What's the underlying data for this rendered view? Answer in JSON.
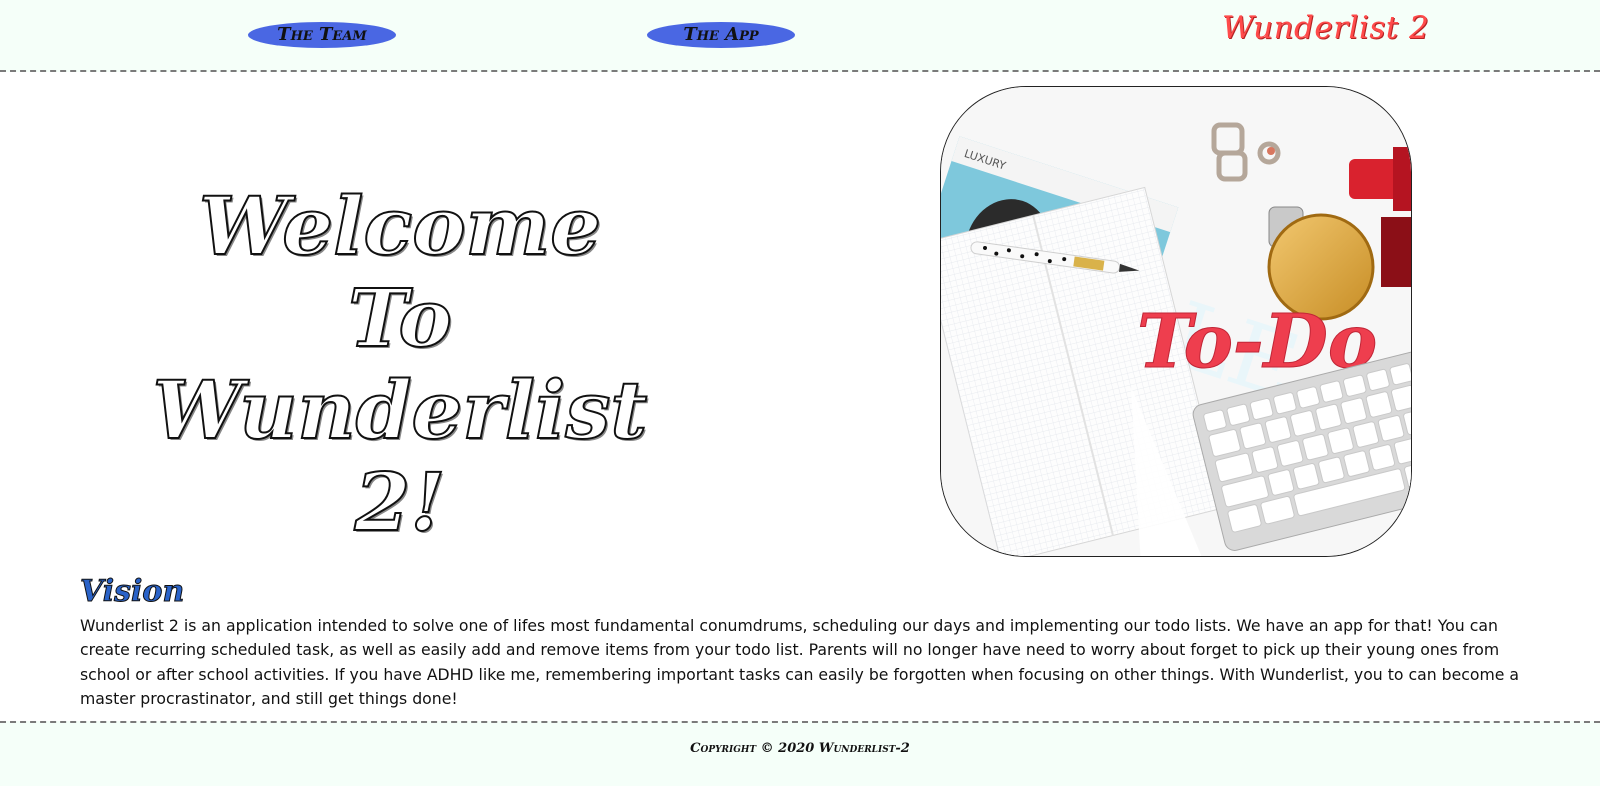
{
  "nav": {
    "team_label": "The Team",
    "app_label": "The App",
    "brand": "Wunderlist 2"
  },
  "hero": {
    "title_lines": [
      "Welcome",
      "To",
      "Wunderlist 2!"
    ],
    "image_text": "To-Do",
    "magazine_label": "LUXURY",
    "magazine_letters": "ELLE"
  },
  "vision": {
    "heading": "Vision",
    "body": "Wunderlist 2 is an application intended to solve one of lifes most fundamental conumdrums, scheduling our days and implementing our todo lists. We have an app for that! You can create recurring scheduled task, as well as easily add and remove items from your todo list. Parents will no longer have need to worry about forget to pick up their young ones from school or after school activities. If you have ADHD like me, remembering important tasks can easily be forgotten when focusing on other things. With Wunderlist, you to can become a master procrastinator, and still get things done!"
  },
  "footer": {
    "copyright": "Copyright © 2020 Wunderlist-2"
  },
  "colors": {
    "accent_blue": "#4a67e3",
    "brand_red": "#ff4b4b",
    "header_bg": "#f5fff9"
  }
}
